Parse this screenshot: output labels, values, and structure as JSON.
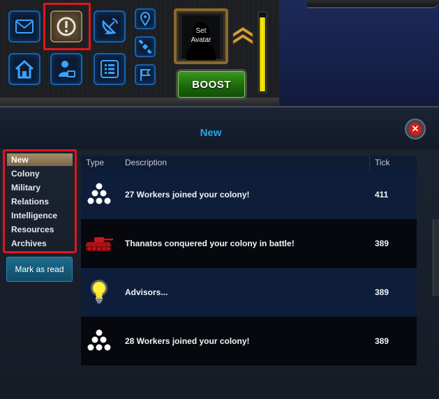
{
  "hud": {
    "avatar_text": "Set\nAvatar",
    "boost_label": "BOOST",
    "energy_level": 0.93,
    "icons": {
      "row1": [
        "mail-icon",
        "alert-icon",
        "satellite-dish-icon"
      ],
      "row2": [
        "home-icon",
        "advisor-icon",
        "list-icon"
      ],
      "small": [
        "map-pin-icon",
        "satellite-icon",
        "flag-icon"
      ]
    }
  },
  "window": {
    "title": "New",
    "close_symbol": "✕"
  },
  "sidebar": {
    "items": [
      {
        "label": "New",
        "selected": true
      },
      {
        "label": "Colony",
        "selected": false
      },
      {
        "label": "Military",
        "selected": false
      },
      {
        "label": "Relations",
        "selected": false
      },
      {
        "label": "Intelligence",
        "selected": false
      },
      {
        "label": "Resources",
        "selected": false
      },
      {
        "label": "Archives",
        "selected": false
      }
    ],
    "mark_read_label": "Mark as read"
  },
  "table": {
    "headers": {
      "type": "Type",
      "description": "Description",
      "tick": "Tick"
    },
    "rows": [
      {
        "icon": "workers-icon",
        "description": "27 Workers joined your colony!",
        "tick": "411"
      },
      {
        "icon": "tank-icon",
        "description": "Thanatos conquered your colony in battle!",
        "tick": "389"
      },
      {
        "icon": "lightbulb-icon",
        "description": "Advisors...",
        "tick": "389"
      },
      {
        "icon": "workers-icon",
        "description": "28 Workers joined your colony!",
        "tick": "389"
      }
    ]
  },
  "colors": {
    "accent_blue": "#2ba4e5",
    "highlight_red": "#e0161c",
    "boost_green": "#2d8618",
    "energy_yellow": "#fff200"
  }
}
